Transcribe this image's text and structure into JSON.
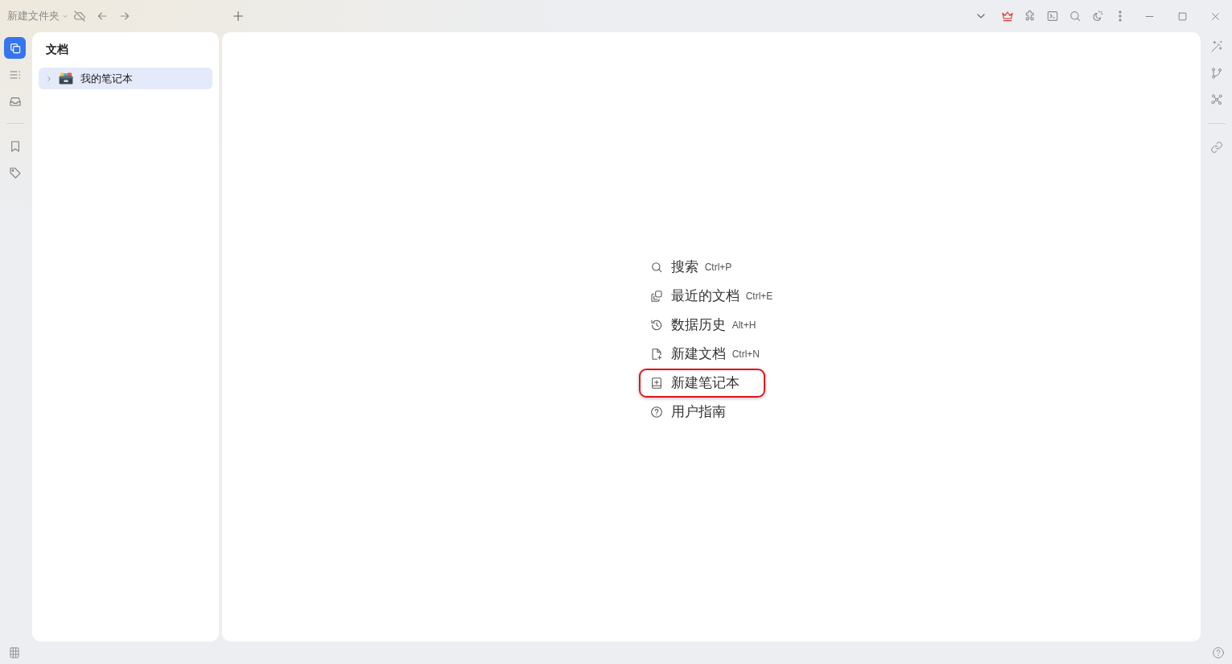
{
  "title_bar": {
    "title": "新建文件夹"
  },
  "left_dock": {
    "top": [
      {
        "selected": true
      },
      {
        "selected": false
      },
      {
        "selected": false
      }
    ],
    "bottom": [
      {
        "selected": false
      },
      {
        "selected": false
      }
    ]
  },
  "docs_panel": {
    "title": "文档",
    "notebooks": [
      {
        "name": "我的笔记本",
        "expanded": false,
        "selected": true
      }
    ]
  },
  "main": {
    "actions": [
      {
        "label": "搜索",
        "shortcut": "Ctrl+P",
        "highlighted": false
      },
      {
        "label": "最近的文档",
        "shortcut": "Ctrl+E",
        "highlighted": false
      },
      {
        "label": "数据历史",
        "shortcut": "Alt+H",
        "highlighted": false
      },
      {
        "label": "新建文档",
        "shortcut": "Ctrl+N",
        "highlighted": false
      },
      {
        "label": "新建笔记本",
        "highlighted": true
      },
      {
        "label": "用户指南",
        "highlighted": false
      }
    ]
  }
}
